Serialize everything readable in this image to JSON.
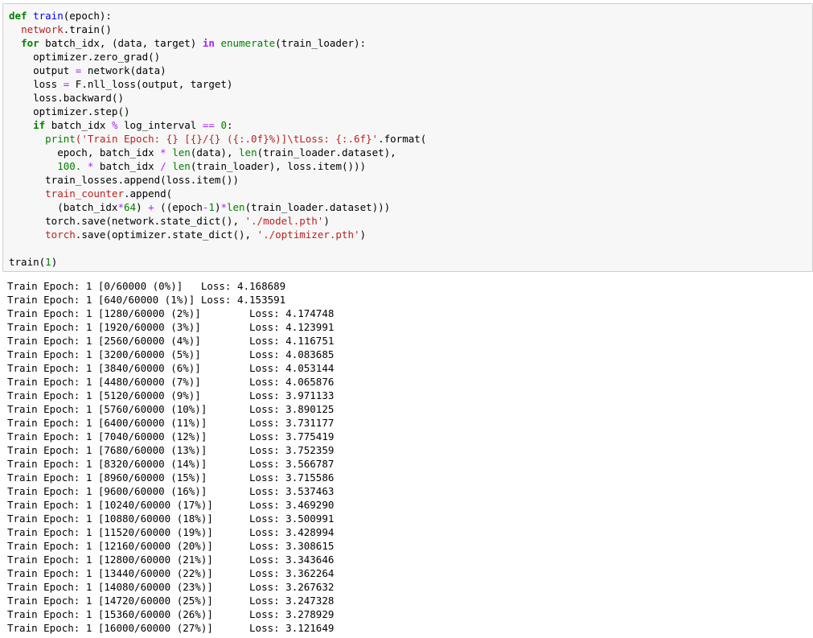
{
  "code_cell": {
    "lines": [
      [
        {
          "t": "def",
          "c": "kw"
        },
        {
          "t": " ",
          "c": ""
        },
        {
          "t": "train",
          "c": "fn"
        },
        {
          "t": "(epoch):",
          "c": ""
        }
      ],
      [
        {
          "t": "  ",
          "c": ""
        },
        {
          "t": "network",
          "c": "str"
        },
        {
          "t": ".train()",
          "c": ""
        }
      ],
      [
        {
          "t": "  ",
          "c": ""
        },
        {
          "t": "for",
          "c": "kw"
        },
        {
          "t": " batch_idx, (data, target) ",
          "c": ""
        },
        {
          "t": "in",
          "c": "kwop"
        },
        {
          "t": " ",
          "c": ""
        },
        {
          "t": "enumerate",
          "c": "bi"
        },
        {
          "t": "(train_loader):",
          "c": ""
        }
      ],
      [
        {
          "t": "    optimizer.zero_grad()",
          "c": ""
        }
      ],
      [
        {
          "t": "    output ",
          "c": ""
        },
        {
          "t": "=",
          "c": "op"
        },
        {
          "t": " network(data)",
          "c": ""
        }
      ],
      [
        {
          "t": "    loss ",
          "c": ""
        },
        {
          "t": "=",
          "c": "op"
        },
        {
          "t": " F.nll_loss(output, target)",
          "c": ""
        }
      ],
      [
        {
          "t": "    loss.backward()",
          "c": ""
        }
      ],
      [
        {
          "t": "    optimizer.step()",
          "c": ""
        }
      ],
      [
        {
          "t": "    ",
          "c": ""
        },
        {
          "t": "if",
          "c": "kw"
        },
        {
          "t": " batch_idx ",
          "c": ""
        },
        {
          "t": "%",
          "c": "op"
        },
        {
          "t": " log_interval ",
          "c": ""
        },
        {
          "t": "==",
          "c": "op"
        },
        {
          "t": " ",
          "c": ""
        },
        {
          "t": "0",
          "c": "num"
        },
        {
          "t": ":",
          "c": ""
        }
      ],
      [
        {
          "t": "      ",
          "c": ""
        },
        {
          "t": "print",
          "c": "bi"
        },
        {
          "t": "('Train Epoch: {} [{}/{} ({:.0f}%)]\\tLoss: {:.6f}'",
          "c": "str"
        },
        {
          "t": ".format(",
          "c": ""
        }
      ],
      [
        {
          "t": "        epoch, batch_idx ",
          "c": ""
        },
        {
          "t": "*",
          "c": "op"
        },
        {
          "t": " ",
          "c": ""
        },
        {
          "t": "len",
          "c": "bi"
        },
        {
          "t": "(data), ",
          "c": ""
        },
        {
          "t": "len",
          "c": "bi"
        },
        {
          "t": "(train_loader.dataset),",
          "c": ""
        }
      ],
      [
        {
          "t": "        ",
          "c": ""
        },
        {
          "t": "100.",
          "c": "num"
        },
        {
          "t": " ",
          "c": ""
        },
        {
          "t": "*",
          "c": "op"
        },
        {
          "t": " batch_idx ",
          "c": ""
        },
        {
          "t": "/",
          "c": "op"
        },
        {
          "t": " ",
          "c": ""
        },
        {
          "t": "len",
          "c": "bi"
        },
        {
          "t": "(train_loader), loss.item()))",
          "c": ""
        }
      ],
      [
        {
          "t": "      train_losses.append(loss.item())",
          "c": ""
        }
      ],
      [
        {
          "t": "      ",
          "c": ""
        },
        {
          "t": "train_counter",
          "c": "str"
        },
        {
          "t": ".append(",
          "c": ""
        }
      ],
      [
        {
          "t": "        (batch_idx",
          "c": ""
        },
        {
          "t": "*",
          "c": "op"
        },
        {
          "t": "64",
          "c": "num"
        },
        {
          "t": ") ",
          "c": ""
        },
        {
          "t": "+",
          "c": "op"
        },
        {
          "t": " ((epoch",
          "c": ""
        },
        {
          "t": "-",
          "c": "op"
        },
        {
          "t": "1",
          "c": "num"
        },
        {
          "t": ")",
          "c": ""
        },
        {
          "t": "*",
          "c": "op"
        },
        {
          "t": "len",
          "c": "bi"
        },
        {
          "t": "(train_loader.dataset)))",
          "c": ""
        }
      ],
      [
        {
          "t": "      torch.save(network.state_dict(), ",
          "c": ""
        },
        {
          "t": "'./model.pth'",
          "c": "str"
        },
        {
          "t": ")",
          "c": ""
        }
      ],
      [
        {
          "t": "      ",
          "c": ""
        },
        {
          "t": "torch",
          "c": "str"
        },
        {
          "t": ".save(optimizer.state_dict(), ",
          "c": ""
        },
        {
          "t": "'./optimizer.pth'",
          "c": "str"
        },
        {
          "t": ")",
          "c": ""
        }
      ],
      [
        {
          "t": "",
          "c": ""
        }
      ],
      [
        {
          "t": "train(",
          "c": ""
        },
        {
          "t": "1",
          "c": "num"
        },
        {
          "t": ")",
          "c": ""
        }
      ]
    ]
  },
  "output": {
    "lines": [
      "Train Epoch: 1 [0/60000 (0%)]   Loss: 4.168689",
      "Train Epoch: 1 [640/60000 (1%)] Loss: 4.153591",
      "Train Epoch: 1 [1280/60000 (2%)]        Loss: 4.174748",
      "Train Epoch: 1 [1920/60000 (3%)]        Loss: 4.123991",
      "Train Epoch: 1 [2560/60000 (4%)]        Loss: 4.116751",
      "Train Epoch: 1 [3200/60000 (5%)]        Loss: 4.083685",
      "Train Epoch: 1 [3840/60000 (6%)]        Loss: 4.053144",
      "Train Epoch: 1 [4480/60000 (7%)]        Loss: 4.065876",
      "Train Epoch: 1 [5120/60000 (9%)]        Loss: 3.971133",
      "Train Epoch: 1 [5760/60000 (10%)]       Loss: 3.890125",
      "Train Epoch: 1 [6400/60000 (11%)]       Loss: 3.731177",
      "Train Epoch: 1 [7040/60000 (12%)]       Loss: 3.775419",
      "Train Epoch: 1 [7680/60000 (13%)]       Loss: 3.752359",
      "Train Epoch: 1 [8320/60000 (14%)]       Loss: 3.566787",
      "Train Epoch: 1 [8960/60000 (15%)]       Loss: 3.715586",
      "Train Epoch: 1 [9600/60000 (16%)]       Loss: 3.537463",
      "Train Epoch: 1 [10240/60000 (17%)]      Loss: 3.469290",
      "Train Epoch: 1 [10880/60000 (18%)]      Loss: 3.500991",
      "Train Epoch: 1 [11520/60000 (19%)]      Loss: 3.428994",
      "Train Epoch: 1 [12160/60000 (20%)]      Loss: 3.308615",
      "Train Epoch: 1 [12800/60000 (21%)]      Loss: 3.343646",
      "Train Epoch: 1 [13440/60000 (22%)]      Loss: 3.362264",
      "Train Epoch: 1 [14080/60000 (23%)]      Loss: 3.267632",
      "Train Epoch: 1 [14720/60000 (25%)]      Loss: 3.247328",
      "Train Epoch: 1 [15360/60000 (26%)]      Loss: 3.278929",
      "Train Epoch: 1 [16000/60000 (27%)]      Loss: 3.121649"
    ]
  },
  "colors": {
    "cell_background": "#f7f7f7",
    "cell_border": "#cfcfcf",
    "keyword": "#008000",
    "string": "#ba2121",
    "operator": "#aa22ff",
    "function_name": "#0000ff"
  }
}
